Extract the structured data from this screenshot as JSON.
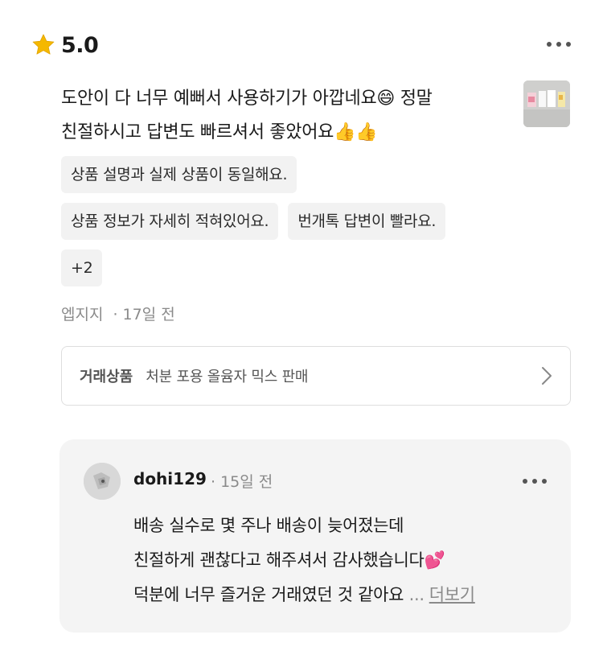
{
  "review": {
    "rating": "5.0",
    "text_line1": "도안이 다 너무 예뻐서 사용하기가 아깝네요😄 정말",
    "text_line2": "친절하시고 답변도 빠르셔서 좋았어요👍👍",
    "tags_row1": [
      "상품 설명과 실제 상품이 동일해요."
    ],
    "tags_row2": [
      "상품 정보가 자세히 적혀있어요.",
      "번개톡 답변이 빨라요."
    ],
    "tags_more": "+2",
    "author": "엡지지",
    "time": "17일 전"
  },
  "trade": {
    "label": "거래상품",
    "product": "처분 포용 올윰자 믹스 판매"
  },
  "reply": {
    "user": "dohi129",
    "time": "15일 전",
    "line1": "배송 실수로 몇 주나 배송이 늦어졌는데",
    "line2": "친절하게 괜찮다고 해주셔서 감사했습니다💕",
    "line3": "덕분에 너무 즐거운 거래였던 것 같아요",
    "ellipsis": "...",
    "more_label": "더보기"
  },
  "icons": {
    "star": "star-icon",
    "more": "more-horizontal-icon",
    "chevron": "chevron-right-icon"
  },
  "colors": {
    "star": "#F5B800",
    "tag_bg": "#F2F2F2",
    "reply_bg": "#F4F4F4",
    "muted_text": "#8A8A8A"
  }
}
